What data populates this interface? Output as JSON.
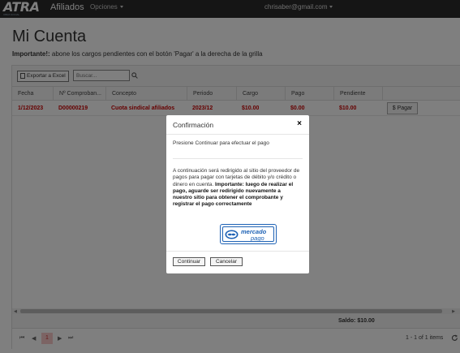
{
  "navbar": {
    "logo_main": "ATRA",
    "logo_accent": "A",
    "logo_tag": "OBRA SOCIAL",
    "brand": "Afiliados",
    "options_label": "Opciones",
    "user_email": "chrisaber@gmail.com"
  },
  "page": {
    "title": "Mi Cuenta",
    "notice_bold": "Importante!:",
    "notice_text": " abone los cargos pendientes con el botón 'Pagar' a la derecha de la grilla"
  },
  "toolbar": {
    "export_label": "Exportar a Excel",
    "search_placeholder": "Buscar..."
  },
  "table": {
    "columns": [
      "Fecha",
      "Nº Comproban...",
      "Concepto",
      "Periodo",
      "Cargo",
      "Pago",
      "Pendiente"
    ],
    "rows": [
      {
        "fecha": "1/12/2023",
        "comprobante": "D00000219",
        "concepto": "Cuota sindical afiliados",
        "periodo": "2023/12",
        "cargo": "$10.00",
        "pago": "$0.00",
        "pendiente": "$10.00",
        "action": "Pagar"
      }
    ],
    "saldo": "Saldo: $10.00"
  },
  "pager": {
    "current_page": "1",
    "items_info": "1 - 1 of 1 items"
  },
  "modal": {
    "title": "Confirmación",
    "close_glyph": "×",
    "intro": "Presione Continuar para efectuar el pago",
    "body_text": "A continuación será redirigido al sitio del proveedor de pagos para pagar con tarjetas de débito y/o crédito o dinero en cuenta.",
    "body_bold": "Importante: luego de realizar el pago, aguarde ser redirigido nuevamente a nuestro sitio para obtener el comprobante y registrar el pago correctamente",
    "logo_line1": "mercado",
    "logo_line2": "pago",
    "continue_label": "Continuar",
    "cancel_label": "Cancelar"
  },
  "colors": {
    "navbar": "#2b2b2b",
    "pending_text": "#cc0000",
    "mercadopago_blue": "#1e62b5"
  }
}
